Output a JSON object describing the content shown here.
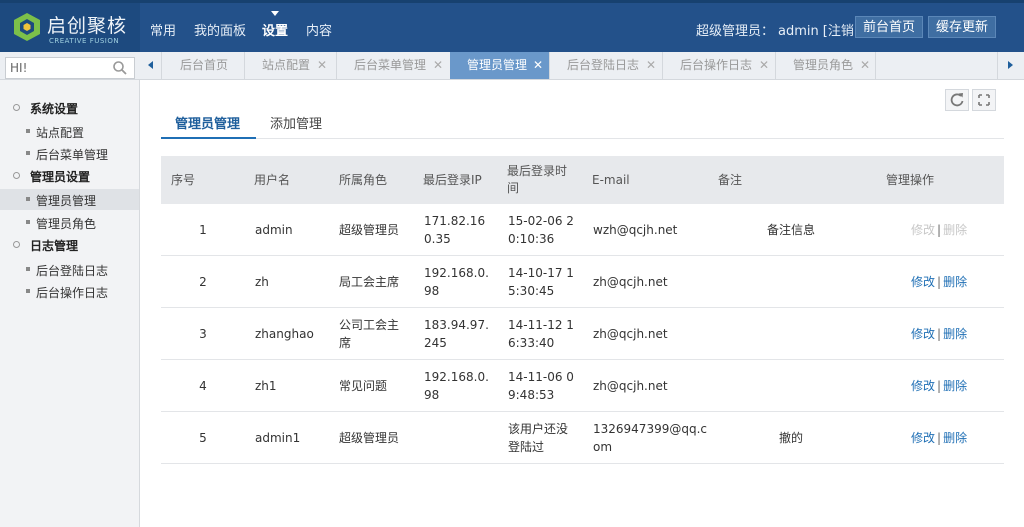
{
  "logo": {
    "cn": "启创聚核",
    "en": "CREATIVE FUSION"
  },
  "nav": {
    "items": [
      "常用",
      "我的面板",
      "设置",
      "内容"
    ],
    "active": "设置"
  },
  "user": {
    "role_label": "超级管理员：",
    "name": "admin",
    "logout": "[注销]"
  },
  "top_buttons": {
    "front": "前台首页",
    "cache": "缓存更新"
  },
  "search": {
    "value": "HI!"
  },
  "tabs": [
    {
      "label": "后台首页",
      "closable": false,
      "active": false
    },
    {
      "label": "站点配置",
      "closable": true,
      "active": false
    },
    {
      "label": "后台菜单管理",
      "closable": true,
      "active": false
    },
    {
      "label": "管理员管理",
      "closable": true,
      "active": true
    },
    {
      "label": "后台登陆日志",
      "closable": true,
      "active": false
    },
    {
      "label": "后台操作日志",
      "closable": true,
      "active": false
    },
    {
      "label": "管理员角色",
      "closable": true,
      "active": false
    }
  ],
  "sidebar": {
    "groups": [
      {
        "label": "系统设置",
        "items": [
          "站点配置",
          "后台菜单管理"
        ]
      },
      {
        "label": "管理员设置",
        "items": [
          "管理员管理",
          "管理员角色"
        ]
      },
      {
        "label": "日志管理",
        "items": [
          "后台登陆日志",
          "后台操作日志"
        ]
      }
    ],
    "active_item": "管理员管理"
  },
  "subtabs": {
    "list": "管理员管理",
    "add": "添加管理"
  },
  "table": {
    "headers": {
      "seq": "序号",
      "username": "用户名",
      "role": "所属角色",
      "ip": "最后登录IP",
      "time": [
        "最后登录时",
        "间"
      ],
      "email": "E-mail",
      "remark": "备注",
      "ops": "管理操作"
    },
    "ops": {
      "edit": "修改",
      "sep": "|",
      "delete": "删除"
    },
    "rows": [
      {
        "seq": "1",
        "username": "admin",
        "role": [
          "超级管理员"
        ],
        "ip": [
          "171.82.16",
          "0.35"
        ],
        "time": [
          "15-02-06 2",
          "0:10:36"
        ],
        "email": [
          "wzh@qcjh.net"
        ],
        "remark": "备注信息",
        "ops_disabled": true
      },
      {
        "seq": "2",
        "username": "zh",
        "role": [
          "局工会主席"
        ],
        "ip": [
          "192.168.0.",
          "98"
        ],
        "time": [
          "14-10-17 1",
          "5:30:45"
        ],
        "email": [
          "zh@qcjh.net"
        ],
        "remark": "",
        "ops_disabled": false
      },
      {
        "seq": "3",
        "username": "zhanghao",
        "role": [
          "公司工会主",
          "席"
        ],
        "ip": [
          "183.94.97.",
          "245"
        ],
        "time": [
          "14-11-12 1",
          "6:33:40"
        ],
        "email": [
          "zh@qcjh.net"
        ],
        "remark": "",
        "ops_disabled": false
      },
      {
        "seq": "4",
        "username": "zh1",
        "role": [
          "常见问题"
        ],
        "ip": [
          "192.168.0.",
          "98"
        ],
        "time": [
          "14-11-06 0",
          "9:48:53"
        ],
        "email": [
          "zh@qcjh.net"
        ],
        "remark": "",
        "ops_disabled": false
      },
      {
        "seq": "5",
        "username": "admin1",
        "role": [
          "超级管理员"
        ],
        "ip": [],
        "time": [
          "该用户还没",
          "登陆过"
        ],
        "email": [
          "1326947399@qq.c",
          "om"
        ],
        "remark": "撤的",
        "ops_disabled": false
      }
    ]
  },
  "icons": {
    "search": "search-icon",
    "refresh": "refresh-icon",
    "fullscreen": "fullscreen-icon",
    "close": "close-icon"
  },
  "colors": {
    "topbar": "#23518a",
    "active_tab": "#6a98ca",
    "link": "#1f6fb5"
  }
}
